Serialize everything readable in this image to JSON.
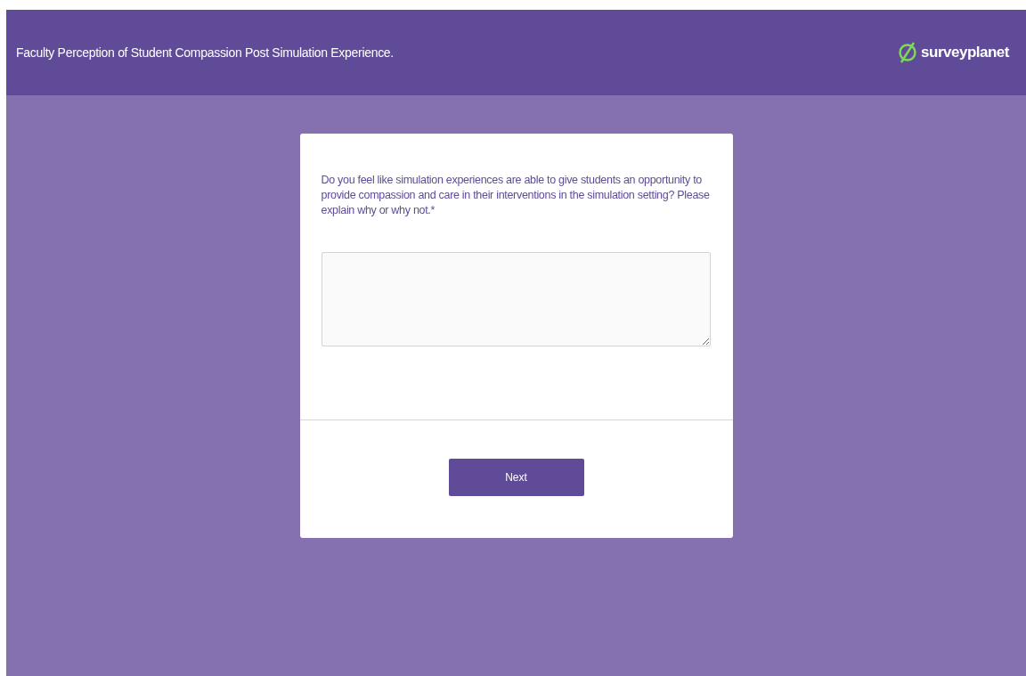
{
  "header": {
    "title": "Faculty Perception of Student Compassion Post Simulation Experience.",
    "logo_text": "surveyplanet"
  },
  "question": {
    "text": "Do you feel like simulation experiences are able to give students an opportunity to provide compassion and care in their interventions in the simulation setting? Please explain why or why not.",
    "required_mark": "*"
  },
  "buttons": [
    "Next"
  ]
}
